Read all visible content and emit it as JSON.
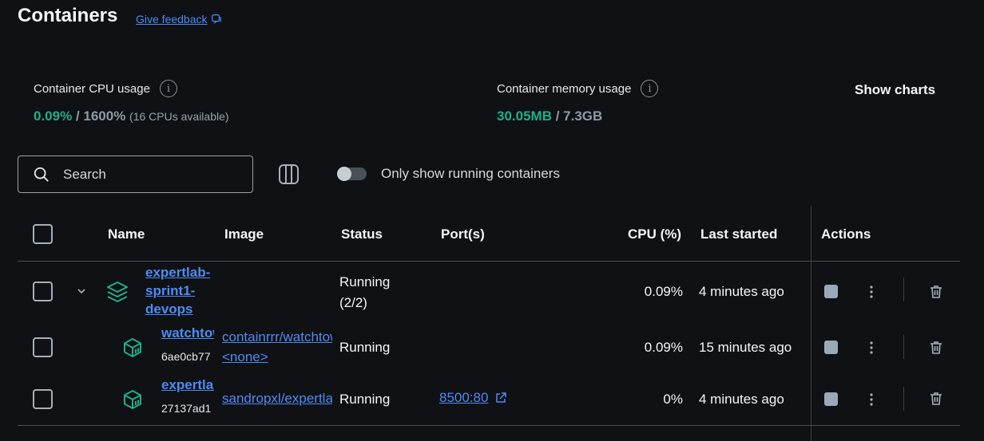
{
  "header": {
    "title": "Containers",
    "feedback_label": "Give feedback"
  },
  "stats": {
    "cpu_label": "Container CPU usage",
    "cpu_used": "0.09%",
    "cpu_sep": " / ",
    "cpu_total": "1600%",
    "cpu_note": "(16 CPUs available)",
    "memory_label": "Container memory usage",
    "memory_used": "30.05MB",
    "memory_sep": " / ",
    "memory_total": "7.3GB",
    "show_charts_label": "Show charts",
    "info_glyph": "i"
  },
  "toolbar": {
    "search_placeholder": "Search",
    "toggle_label": "Only show running containers",
    "toggle_on": false
  },
  "table": {
    "headers": {
      "name": "Name",
      "image": "Image",
      "status": "Status",
      "ports": "Port(s)",
      "cpu": "CPU (%)",
      "last_started": "Last started",
      "actions": "Actions"
    },
    "rows": [
      {
        "name": "expertlab-sprint1-devops",
        "status_line1": "Running",
        "status_line2": "(2/2)",
        "cpu": "0.09%",
        "last_started": "4 minutes ago"
      },
      {
        "name": "watchtower",
        "id": "6ae0cb77",
        "image_line1": "containrrr/watchtower",
        "image_line2": "<none>",
        "status": "Running",
        "cpu": "0.09%",
        "last_started": "15 minutes ago"
      },
      {
        "name": "expertlab",
        "id": "27137ad1",
        "image": "sandropxl/expertlab",
        "status": "Running",
        "port": "8500:80",
        "cpu": "0%",
        "last_started": "4 minutes ago"
      }
    ]
  },
  "colors": {
    "background": "#0f1114",
    "accent_green": "#1fae8f",
    "link_blue": "#4d8cf5",
    "stop_button": "#9aa8b8"
  },
  "icons": {
    "feedback": "external-feedback-icon",
    "search": "search-icon",
    "columns": "columns-icon",
    "group": "stack-layers-icon",
    "container": "cube-icon",
    "stop": "stop-icon",
    "more": "kebab-menu-icon",
    "delete": "trash-icon",
    "external_link": "external-link-icon",
    "chevron": "chevron-down-icon"
  }
}
